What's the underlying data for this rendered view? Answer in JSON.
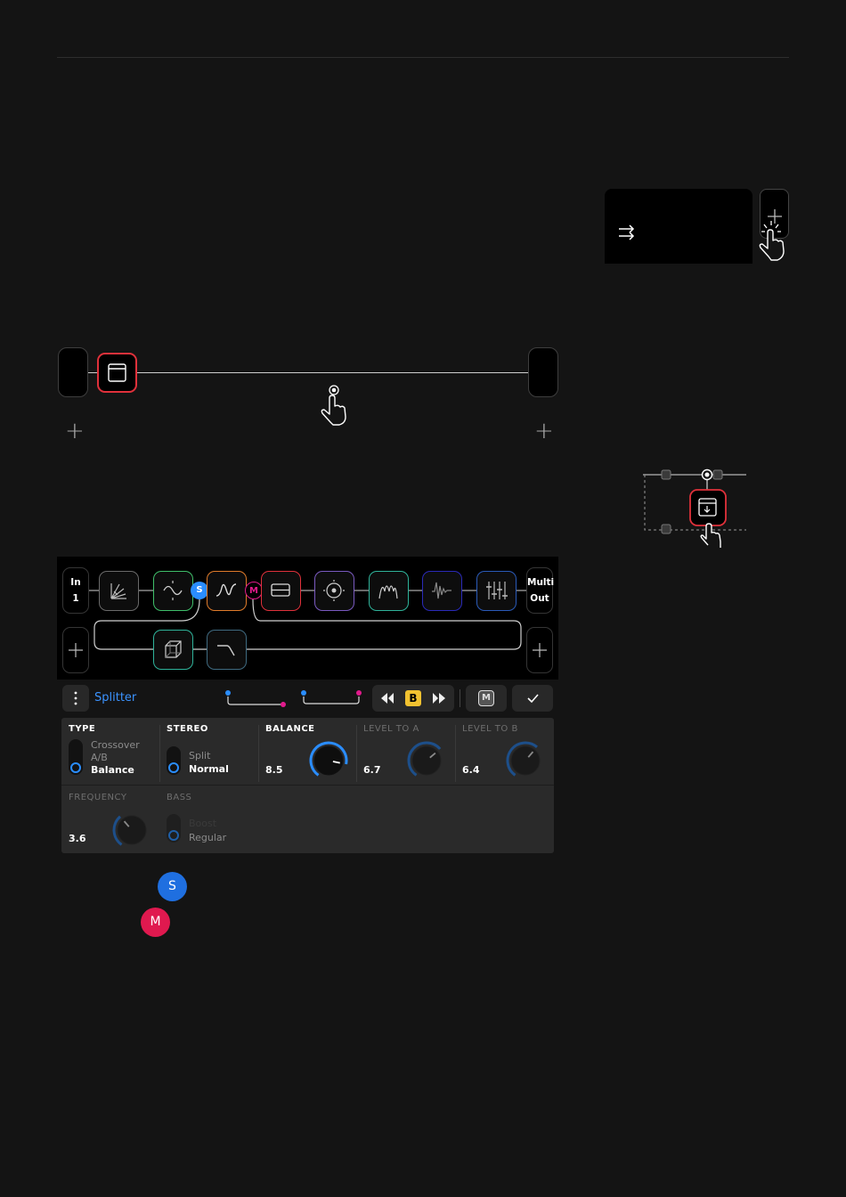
{
  "colors": {
    "background": "#141414",
    "accent_blue": "#2a8dff",
    "accent_red": "#e0313b",
    "accent_magenta": "#e11a8c",
    "accent_yellow": "#f2c230"
  },
  "chain": {
    "input": {
      "line1": "In",
      "line2": "1"
    },
    "output": {
      "line1": "Multi",
      "line2": "Out"
    },
    "split_dot": "S",
    "merge_dot": "M"
  },
  "toolbar": {
    "title": "Splitter",
    "snapshot_label": "B",
    "merge_badge": "M"
  },
  "params": {
    "type": {
      "label": "TYPE",
      "options": [
        "Crossover",
        "A/B",
        "Balance"
      ],
      "selected": "Balance"
    },
    "stereo": {
      "label": "STEREO",
      "options": [
        "Split",
        "Normal"
      ],
      "selected": "Normal"
    },
    "balance": {
      "label": "BALANCE",
      "value": "8.5",
      "level": 0.85
    },
    "level_to_a": {
      "label": "LEVEL TO A",
      "value": "6.7",
      "level": 0.67
    },
    "level_to_b": {
      "label": "LEVEL TO B",
      "value": "6.4",
      "level": 0.64
    },
    "frequency": {
      "label": "FREQUENCY",
      "value": "3.6",
      "level": 0.36
    },
    "bass": {
      "label": "BASS",
      "options": [
        "Boost",
        "Regular"
      ],
      "selected": "Regular"
    }
  },
  "legend": {
    "split": "S",
    "merge": "M"
  }
}
